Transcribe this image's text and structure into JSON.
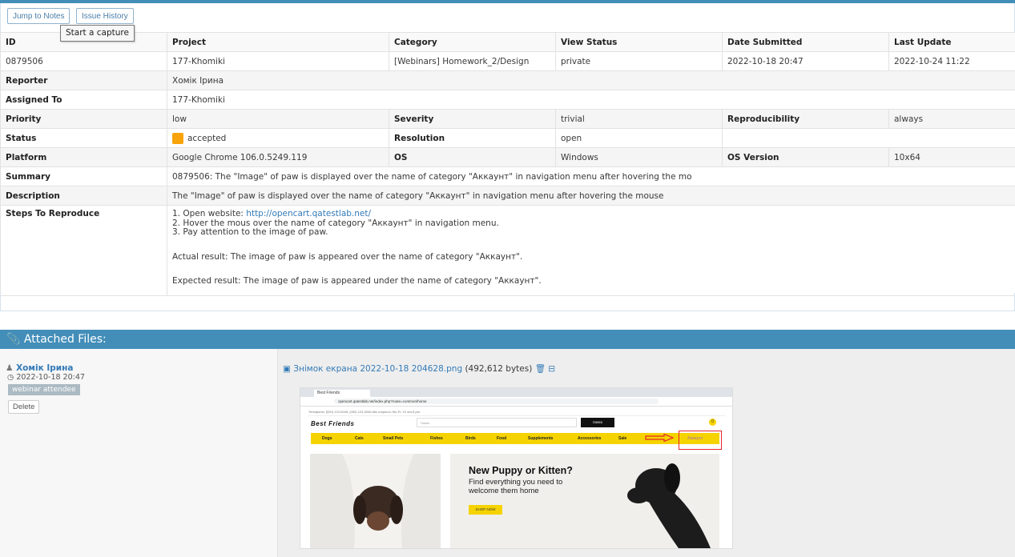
{
  "toolbar": {
    "jump_label": "Jump to Notes",
    "history_label": "Issue History",
    "tooltip": "Start a capture"
  },
  "headers": {
    "id": "ID",
    "project": "Project",
    "category": "Category",
    "view_status": "View Status",
    "date_submitted": "Date Submitted",
    "last_update": "Last Update"
  },
  "issue": {
    "id": "0879506",
    "project": "177-Khomiki",
    "category": "[Webinars] Homework_2/Design",
    "view_status": "private",
    "date_submitted": "2022-10-18 20:47",
    "last_update": "2022-10-24 11:22",
    "reporter_label": "Reporter",
    "reporter": "Хомік Ірина",
    "assigned_label": "Assigned To",
    "assigned": "177-Khomiki",
    "priority_label": "Priority",
    "priority": "low",
    "severity_label": "Severity",
    "severity": "trivial",
    "repro_label": "Reproducibility",
    "repro": "always",
    "status_label": "Status",
    "status": "accepted",
    "status_color": "#f8a30a",
    "resolution_label": "Resolution",
    "resolution": "open",
    "platform_label": "Platform",
    "platform": "Google Chrome 106.0.5249.119",
    "os_label": "OS",
    "os": "Windows",
    "os_version_label": "OS Version",
    "os_version": "10x64",
    "summary_label": "Summary",
    "summary": "0879506: The \"Image\" of paw is displayed over the name of category \"Аккаунт\" in navigation menu after hovering the mo",
    "description_label": "Description",
    "description": "The \"Image\" of paw is displayed over the name of category \"Аккаунт\" in navigation menu after hovering the mouse",
    "steps_label": "Steps To Reproduce",
    "steps_1_prefix": "1. Open website: ",
    "steps_1_link": "http://opencart.qatestlab.net/",
    "steps_2": "2. Hover the mous over the name of category \"Аккаунт\" in navigation menu.",
    "steps_3": "3. Pay attention to the image of paw.",
    "actual": "Actual result: The image of paw is appeared over the name of category \"Аккаунт\".",
    "expected": "Expected result: The image of paw is appeared under the name of category \"Аккаунт\"."
  },
  "attachments": {
    "title": "Attached Files:",
    "title_icon": "paperclip-icon",
    "user": "Хомік Ірина",
    "date": "2022-10-18 20:47",
    "tag": "webinar attendee",
    "delete_label": "Delete",
    "file_name": "Знімок екрана 2022-10-18 204628.png",
    "file_size": "(492,612 bytes)"
  },
  "screenshot": {
    "tab_title": "Best Friends",
    "url": "opencart.qatestlab.net/index.php?route=common/home",
    "top_info": "Телефоны: (000) 123-0045, (000) 123-0046     Мы открыты: Mn-Fr: 10 am-8 pm",
    "logo": "Best Friends",
    "search_placeholder": "Поиск",
    "search_btn": "поиск",
    "cart_count": "0",
    "nav": [
      "Dogs",
      "Cats",
      "Small Pets",
      "Fishes",
      "Birds",
      "Food",
      "Supplements",
      "Accessories",
      "Sale",
      "Аккаунт"
    ],
    "hero_title": "New Puppy or Kitten?",
    "hero_sub": "Find everything you need to welcome them home",
    "shop_btn": "SHOP NOW"
  },
  "colors": {
    "accent": "#438eb9",
    "link": "#337ab7",
    "status_accepted": "#f8a30a",
    "nav_yellow": "#f5d300"
  }
}
